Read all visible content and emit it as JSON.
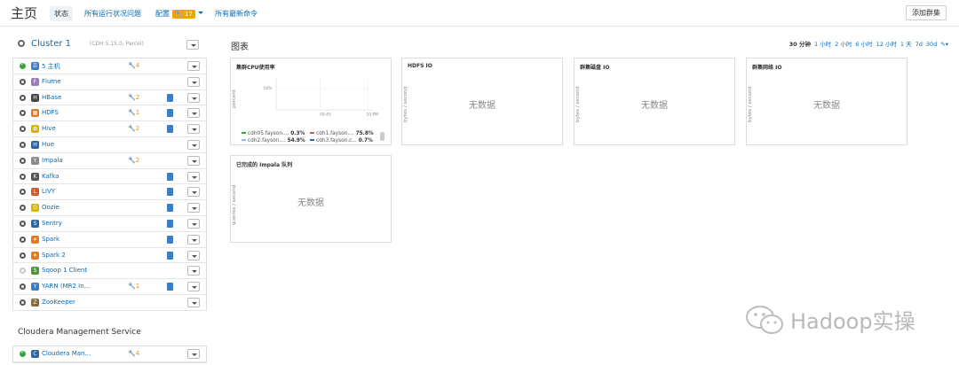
{
  "header": {
    "title": "主页",
    "tabs": [
      {
        "label": "状态"
      },
      {
        "label": "所有运行状况问题"
      },
      {
        "label": "配置",
        "badge": "17"
      },
      {
        "label": "所有最新命令"
      }
    ],
    "add_cluster_label": "添加群集"
  },
  "cluster": {
    "name": "Cluster 1",
    "meta": "(CDH 5.15.0, Parcel)",
    "services": [
      {
        "name": "5 主机",
        "status": "good",
        "warn": "4",
        "doc": false,
        "icon": "hosts-icon",
        "icon_char": "☰",
        "icon_color": "#3c7dc4"
      },
      {
        "name": "Flume",
        "status": "unknown",
        "warn": "",
        "doc": false,
        "icon": "flume-icon",
        "icon_char": "F",
        "icon_color": "#9b7bb8"
      },
      {
        "name": "HBase",
        "status": "unknown",
        "warn": "2",
        "doc": true,
        "icon": "hbase-icon",
        "icon_char": "H",
        "icon_color": "#444"
      },
      {
        "name": "HDFS",
        "status": "unknown",
        "warn": "1",
        "doc": true,
        "icon": "hdfs-icon",
        "icon_char": "▦",
        "icon_color": "#e07b24"
      },
      {
        "name": "Hive",
        "status": "unknown",
        "warn": "2",
        "doc": true,
        "icon": "hive-icon",
        "icon_char": "✿",
        "icon_color": "#d7b500"
      },
      {
        "name": "Hue",
        "status": "unknown",
        "warn": "",
        "doc": false,
        "icon": "hue-icon",
        "icon_char": "H",
        "icon_color": "#2a67a8"
      },
      {
        "name": "Impala",
        "status": "unknown",
        "warn": "2",
        "doc": false,
        "icon": "impala-icon",
        "icon_char": "Y",
        "icon_color": "#8a8a8a"
      },
      {
        "name": "Kafka",
        "status": "unknown",
        "warn": "",
        "doc": true,
        "icon": "kafka-icon",
        "icon_char": "K",
        "icon_color": "#555"
      },
      {
        "name": "LIVY",
        "status": "unknown",
        "warn": "",
        "doc": true,
        "icon": "livy-icon",
        "icon_char": "L",
        "icon_color": "#d05c2c"
      },
      {
        "name": "Oozie",
        "status": "unknown",
        "warn": "",
        "doc": true,
        "icon": "oozie-icon",
        "icon_char": "O",
        "icon_color": "#d7b500"
      },
      {
        "name": "Sentry",
        "status": "unknown",
        "warn": "",
        "doc": true,
        "icon": "sentry-icon",
        "icon_char": "S",
        "icon_color": "#2a67a8"
      },
      {
        "name": "Spark",
        "status": "unknown",
        "warn": "",
        "doc": true,
        "icon": "spark-icon",
        "icon_char": "✶",
        "icon_color": "#e07b24"
      },
      {
        "name": "Spark 2",
        "status": "unknown",
        "warn": "",
        "doc": true,
        "icon": "spark2-icon",
        "icon_char": "✶",
        "icon_color": "#e07b24"
      },
      {
        "name": "Sqoop 1 Client",
        "status": "none",
        "warn": "",
        "doc": false,
        "icon": "sqoop-icon",
        "icon_char": "S",
        "icon_color": "#4a9a3a"
      },
      {
        "name": "YARN (MR2 In...",
        "status": "unknown",
        "warn": "1",
        "doc": true,
        "icon": "yarn-icon",
        "icon_char": "Y",
        "icon_color": "#3c7dc4"
      },
      {
        "name": "ZooKeeper",
        "status": "unknown",
        "warn": "",
        "doc": false,
        "icon": "zookeeper-icon",
        "icon_char": "Z",
        "icon_color": "#8b6b3a"
      }
    ]
  },
  "management": {
    "title": "Cloudera Management Service",
    "services": [
      {
        "name": "Cloudera Man...",
        "status": "good",
        "warn": "4",
        "doc": false,
        "icon": "cloudera-manager-icon",
        "icon_char": "C",
        "icon_color": "#2a67a8"
      }
    ]
  },
  "charts": {
    "title": "图表",
    "time_ranges": [
      "30 分钟",
      "1 小时",
      "2 小时",
      "6 小时",
      "12 小时",
      "1 天",
      "7d",
      "30d"
    ],
    "selected_range": "30 分钟",
    "cards": [
      {
        "title": "集群CPU使用率",
        "ylabel": "percent",
        "nodata": ""
      },
      {
        "title": "HDFS IO",
        "ylabel": "bytes / second",
        "nodata": "无数据"
      },
      {
        "title": "群集磁盘 IO",
        "ylabel": "bytes / second",
        "nodata": "无数据"
      },
      {
        "title": "群集网络 IO",
        "ylabel": "bytes / second",
        "nodata": "无数据"
      },
      {
        "title": "已完成的 Impala 队列",
        "ylabel": "queries / second",
        "nodata": "无数据"
      }
    ]
  },
  "chart_data": {
    "type": "line",
    "title": "集群CPU使用率",
    "ylabel": "percent",
    "y_tick": "50%",
    "x_ticks": [
      "09:45",
      "10 PM"
    ],
    "series": [
      {
        "name": "cdh05.fayson....",
        "value": "0.3%",
        "color": "#3aa53a"
      },
      {
        "name": "cdh1.fayson....",
        "value": "75.8%",
        "color": "#d9534f"
      },
      {
        "name": "cdh2.fayson....",
        "value": "54.9%",
        "color": "#9fb8d8"
      },
      {
        "name": "cdh3.fayson.c...",
        "value": "0.7%",
        "color": "#2a67a8"
      }
    ]
  },
  "watermark": {
    "text": "Hadoop实操"
  }
}
